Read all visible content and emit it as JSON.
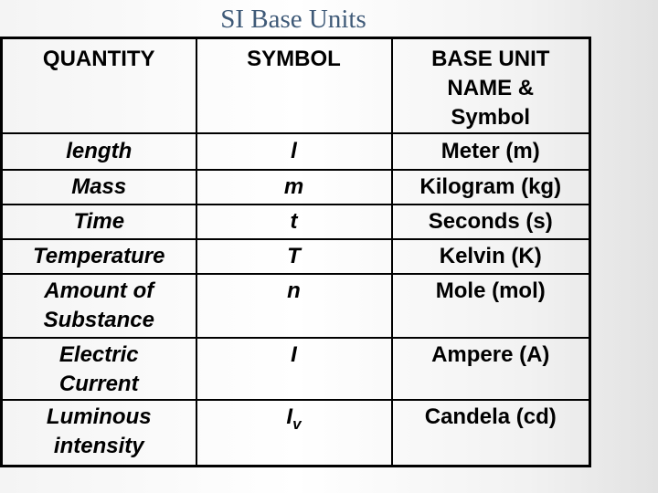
{
  "slide": {
    "title": "SI Base Units"
  },
  "table": {
    "headers": {
      "quantity": "QUANTITY",
      "symbol": "SYMBOL",
      "unit_line1": "BASE UNIT",
      "unit_line2": "NAME &",
      "unit_line3": "Symbol"
    },
    "rows": [
      {
        "quantity_line1": "length",
        "quantity_line2": "",
        "symbol": "l",
        "symbol_sub": "",
        "unit": "Meter (m)"
      },
      {
        "quantity_line1": "Mass",
        "quantity_line2": "",
        "symbol": "m",
        "symbol_sub": "",
        "unit": "Kilogram (kg)"
      },
      {
        "quantity_line1": "Time",
        "quantity_line2": "",
        "symbol": "t",
        "symbol_sub": "",
        "unit": "Seconds (s)"
      },
      {
        "quantity_line1": "Temperature",
        "quantity_line2": "",
        "symbol": "T",
        "symbol_sub": "",
        "unit": "Kelvin (K)"
      },
      {
        "quantity_line1": "Amount of",
        "quantity_line2": "Substance",
        "symbol": "n",
        "symbol_sub": "",
        "unit": "Mole (mol)"
      },
      {
        "quantity_line1": "Electric",
        "quantity_line2": "Current",
        "symbol": "I",
        "symbol_sub": "",
        "unit": "Ampere (A)"
      },
      {
        "quantity_line1": "Luminous",
        "quantity_line2": "intensity",
        "symbol": "I",
        "symbol_sub": "v",
        "unit": "Candela (cd)"
      }
    ]
  }
}
